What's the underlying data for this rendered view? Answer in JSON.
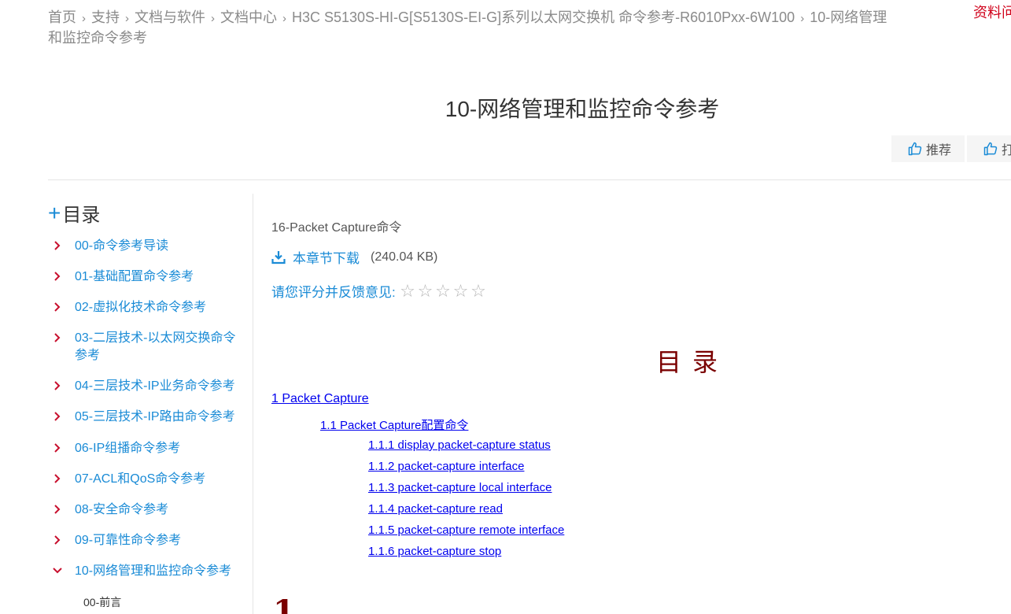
{
  "breadcrumb": {
    "items": [
      "首页",
      "支持",
      "文档与软件",
      "文档中心",
      "H3C S5130S-HI-G[S5130S-EI-G]系列以太网交换机 命令参考-R6010Pxx-6W100",
      "10-网络管理和监控命令参考"
    ]
  },
  "corner_link": "资料问",
  "page_title": "10-网络管理和监控命令参考",
  "actions": {
    "recommend": "推荐",
    "print": "打"
  },
  "sidebar": {
    "title": "目录",
    "items": [
      {
        "label": "00-命令参考导读",
        "expanded": false
      },
      {
        "label": "01-基础配置命令参考",
        "expanded": false
      },
      {
        "label": "02-虚拟化技术命令参考",
        "expanded": false
      },
      {
        "label": "03-二层技术-以太网交换命令参考",
        "expanded": false
      },
      {
        "label": "04-三层技术-IP业务命令参考",
        "expanded": false
      },
      {
        "label": "05-三层技术-IP路由命令参考",
        "expanded": false
      },
      {
        "label": "06-IP组播命令参考",
        "expanded": false
      },
      {
        "label": "07-ACL和QoS命令参考",
        "expanded": false
      },
      {
        "label": "08-安全命令参考",
        "expanded": false
      },
      {
        "label": "09-可靠性命令参考",
        "expanded": false
      },
      {
        "label": "10-网络管理和监控命令参考",
        "expanded": true
      }
    ],
    "sub_item": "00-前言"
  },
  "content": {
    "chapter_name": "16-Packet Capture命令",
    "download_label": "本章节下载",
    "download_size": "(240.04 KB)",
    "rating_label": "请您评分并反馈意见:",
    "rating_stars": 0,
    "rating_max": 5,
    "toc_title": "目录",
    "toc": {
      "l1": "1 Packet Capture",
      "l2": "1.1 Packet Capture配置命令",
      "l3": [
        "1.1.1 display packet-capture status",
        "1.1.2 packet-capture interface",
        "1.1.3 packet-capture local interface",
        "1.1.4 packet-capture read",
        "1.1.5 packet-capture remote interface",
        "1.1.6 packet-capture stop"
      ]
    },
    "chapter_number": "1"
  },
  "colors": {
    "link_blue": "#1a8bd6",
    "chevron_red": "#c8102e",
    "title_dark_red": "#7a0000",
    "toc_link": "#0000ee"
  },
  "icons": {
    "thumbs_up": "thumbs-up-icon",
    "download": "download-icon",
    "chevron_right": "chevron-right-icon",
    "chevron_down": "chevron-down-icon",
    "star": "star-icon"
  }
}
